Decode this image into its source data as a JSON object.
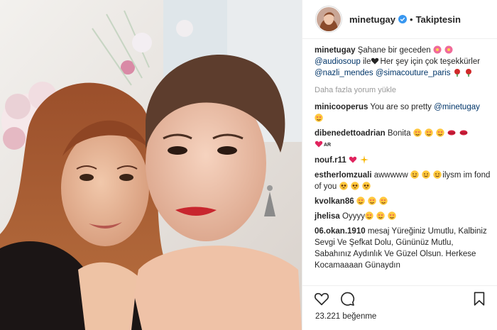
{
  "header": {
    "username": "minetugay",
    "separator": "•",
    "follow_label": "Takiptesin"
  },
  "caption": {
    "username": "minetugay",
    "text_1": "Şahane bir geceden",
    "mention_1": "@audiosoup",
    "text_2": "ile",
    "text_3": "Her şey için çok teşekkürler",
    "mention_2": "@nazli_mendes",
    "mention_3": "@simacouture_paris"
  },
  "load_more_label": "Daha fazla yorum yükle",
  "comments": [
    {
      "username": "minicooperus",
      "text": "You are so pretty",
      "mention": "@minetugay"
    },
    {
      "username": "dibenedettoadrian",
      "text": "Bonita",
      "badge": "AR"
    },
    {
      "username": "nouf.r11"
    },
    {
      "username": "estherlomzuali",
      "text_1": "awwwww",
      "text_2": "ilysm im fond of you"
    },
    {
      "username": "kvolkan86"
    },
    {
      "username": "jhelisa",
      "text": "Oyyyy"
    },
    {
      "username": "06.okan.1910",
      "text": "mesaj Yüreğiniz Umutlu, Kalbiniz Sevgi Ve Şefkat Dolu, Gününüz Mutlu, Sabahınız Aydınlık Ve Güzel Olsun. Herkese Kocamaaaan Günaydın"
    }
  ],
  "likes_label": "23.221 beğenme",
  "icons": {
    "verified": "verified-badge-icon",
    "heart": "heart-outline-icon",
    "comment": "comment-bubble-icon",
    "bookmark": "bookmark-icon"
  },
  "colors": {
    "verified_blue": "#3897f0",
    "mention_blue": "#003569",
    "muted_gray": "#999999",
    "divider": "#efefef"
  }
}
